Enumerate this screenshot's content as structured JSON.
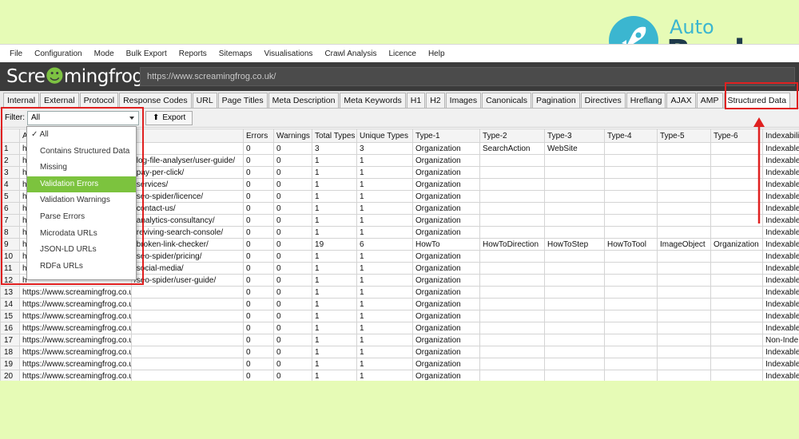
{
  "brand": {
    "auto": "Auto",
    "ranker": "Ranker"
  },
  "menu": [
    "File",
    "Configuration",
    "Mode",
    "Bulk Export",
    "Reports",
    "Sitemaps",
    "Visualisations",
    "Crawl Analysis",
    "Licence",
    "Help"
  ],
  "logo": {
    "part1": "Scre",
    "part2": "mingfrog"
  },
  "url": "https://www.screamingfrog.co.uk/",
  "tabs": [
    "Internal",
    "External",
    "Protocol",
    "Response Codes",
    "URL",
    "Page Titles",
    "Meta Description",
    "Meta Keywords",
    "H1",
    "H2",
    "Images",
    "Canonicals",
    "Pagination",
    "Directives",
    "Hreflang",
    "AJAX",
    "AMP",
    "Structured Data"
  ],
  "filter": {
    "label": "Filter:",
    "value": "All"
  },
  "export_label": "Export",
  "dropdown": {
    "items": [
      "All",
      "Contains Structured Data",
      "Missing",
      "Validation Errors",
      "Validation Warnings",
      "Parse Errors",
      "Microdata URLs",
      "JSON-LD URLs",
      "RDFa URLs"
    ],
    "selected": "Validation Errors"
  },
  "columns": [
    "",
    "A",
    "Errors",
    "Warnings",
    "Total Types",
    "Unique Types",
    "Type-1",
    "Type-2",
    "Type-3",
    "Type-4",
    "Type-5",
    "Type-6",
    "Indexabili"
  ],
  "rows": [
    [
      "1",
      "h",
      "/",
      "0",
      "0",
      "3",
      "3",
      "Organization",
      "SearchAction",
      "WebSite",
      "",
      "",
      "",
      "Indexable"
    ],
    [
      "2",
      "h",
      "/log-file-analyser/user-guide/",
      "0",
      "0",
      "1",
      "1",
      "Organization",
      "",
      "",
      "",
      "",
      "",
      "Indexable"
    ],
    [
      "3",
      "h",
      "/pay-per-click/",
      "0",
      "0",
      "1",
      "1",
      "Organization",
      "",
      "",
      "",
      "",
      "",
      "Indexable"
    ],
    [
      "4",
      "h",
      "/services/",
      "0",
      "0",
      "1",
      "1",
      "Organization",
      "",
      "",
      "",
      "",
      "",
      "Indexable"
    ],
    [
      "5",
      "h",
      "/seo-spider/licence/",
      "0",
      "0",
      "1",
      "1",
      "Organization",
      "",
      "",
      "",
      "",
      "",
      "Indexable"
    ],
    [
      "6",
      "h",
      "/contact-us/",
      "0",
      "0",
      "1",
      "1",
      "Organization",
      "",
      "",
      "",
      "",
      "",
      "Indexable"
    ],
    [
      "7",
      "h",
      "/analytics-consultancy/",
      "0",
      "0",
      "1",
      "1",
      "Organization",
      "",
      "",
      "",
      "",
      "",
      "Indexable"
    ],
    [
      "8",
      "h",
      "/reviving-search-console/",
      "0",
      "0",
      "1",
      "1",
      "Organization",
      "",
      "",
      "",
      "",
      "",
      "Indexable"
    ],
    [
      "9",
      "h",
      "/broken-link-checker/",
      "0",
      "0",
      "19",
      "6",
      "HowTo",
      "HowToDirection",
      "HowToStep",
      "HowToTool",
      "ImageObject",
      "Organization",
      "Indexable"
    ],
    [
      "10",
      "h",
      "/seo-spider/pricing/",
      "0",
      "0",
      "1",
      "1",
      "Organization",
      "",
      "",
      "",
      "",
      "",
      "Indexable"
    ],
    [
      "11",
      "h",
      "/social-media/",
      "0",
      "0",
      "1",
      "1",
      "Organization",
      "",
      "",
      "",
      "",
      "",
      "Indexable"
    ],
    [
      "12",
      "h",
      "/seo-spider/user-guide/",
      "0",
      "0",
      "1",
      "1",
      "Organization",
      "",
      "",
      "",
      "",
      "",
      "Indexable"
    ],
    [
      "13",
      "https://www.screamingfrog.co.uk/about/",
      "",
      "0",
      "0",
      "1",
      "1",
      "Organization",
      "",
      "",
      "",
      "",
      "",
      "Indexable"
    ],
    [
      "14",
      "https://www.screamingfrog.co.uk/adwords-history/",
      "",
      "0",
      "0",
      "1",
      "1",
      "Organization",
      "",
      "",
      "",
      "",
      "",
      "Indexable"
    ],
    [
      "15",
      "https://www.screamingfrog.co.uk/log-file-analyser/",
      "",
      "0",
      "0",
      "1",
      "1",
      "Organization",
      "",
      "",
      "",
      "",
      "",
      "Indexable"
    ],
    [
      "16",
      "https://www.screamingfrog.co.uk/our-work/",
      "",
      "0",
      "0",
      "1",
      "1",
      "Organization",
      "",
      "",
      "",
      "",
      "",
      "Indexable"
    ],
    [
      "17",
      "https://www.screamingfrog.co.uk/login/",
      "",
      "0",
      "0",
      "1",
      "1",
      "Organization",
      "",
      "",
      "",
      "",
      "",
      "Non-Inde"
    ],
    [
      "18",
      "https://www.screamingfrog.co.uk/clients/",
      "",
      "0",
      "0",
      "1",
      "1",
      "Organization",
      "",
      "",
      "",
      "",
      "",
      "Indexable"
    ],
    [
      "19",
      "https://www.screamingfrog.co.uk/google-grants-account-sus...",
      "",
      "0",
      "0",
      "1",
      "1",
      "Organization",
      "",
      "",
      "",
      "",
      "",
      "Indexable"
    ],
    [
      "20",
      "https://www.screamingfrog.co.uk/meet-the-team/",
      "",
      "0",
      "0",
      "1",
      "1",
      "Organization",
      "",
      "",
      "",
      "",
      "",
      "Indexable"
    ]
  ]
}
